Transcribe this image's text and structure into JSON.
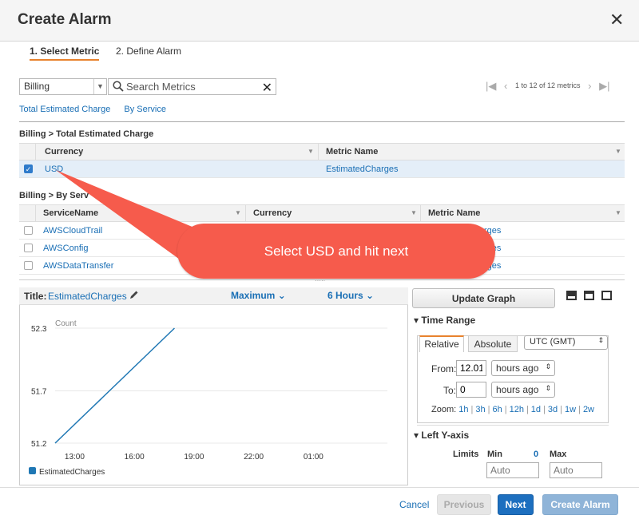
{
  "dialog": {
    "title": "Create Alarm"
  },
  "wizard": {
    "step1": "1. Select Metric",
    "step2": "2. Define Alarm"
  },
  "filter": {
    "namespace": "Billing",
    "search_placeholder": "Search Metrics",
    "pager_text": "1 to 12 of 12 metrics"
  },
  "subtabs": [
    "Total Estimated Charge",
    "By Service"
  ],
  "group1": {
    "title": "Billing > Total Estimated Charge",
    "headers": [
      "Currency",
      "Metric Name"
    ],
    "rows": [
      {
        "currency": "USD",
        "metric": "EstimatedCharges",
        "checked": true
      }
    ]
  },
  "group2": {
    "title": "Billing > By Service",
    "title_visible": "Billing > By Serv",
    "headers": [
      "ServiceName",
      "Currency",
      "Metric Name"
    ],
    "rows": [
      {
        "service": "AWSCloudTrail",
        "metric_tail": "rges"
      },
      {
        "service": "AWSConfig",
        "metric_tail": "rges"
      },
      {
        "service": "AWSDataTransfer",
        "metric_tail": "rges"
      }
    ]
  },
  "callout": {
    "text": "Select USD and hit next"
  },
  "graph": {
    "title_label": "Title:",
    "title_value": "EstimatedCharges",
    "statistic": "Maximum",
    "period": "6 Hours",
    "legend": "EstimatedCharges"
  },
  "chart_data": {
    "type": "line",
    "ylabel": "Count",
    "y_ticks": [
      "52.3",
      "51.7",
      "51.2"
    ],
    "x_ticks": [
      "13:00",
      "16:00",
      "19:00",
      "22:00",
      "01:00"
    ],
    "ylim": [
      51.2,
      52.3
    ],
    "series": [
      {
        "name": "EstimatedCharges",
        "x": [
          "12:00",
          "18:00"
        ],
        "values": [
          51.2,
          52.3
        ]
      }
    ],
    "grid": true
  },
  "right": {
    "update_button": "Update Graph",
    "time_range_title": "Time Range",
    "tab_relative": "Relative",
    "tab_absolute": "Absolute",
    "timezone": "UTC (GMT)",
    "from_label": "From:",
    "from_value": "12.01",
    "from_unit": "hours ago",
    "to_label": "To:",
    "to_value": "0",
    "to_unit": "hours ago",
    "zoom_label": "Zoom:",
    "zoom_options": [
      "1h",
      "3h",
      "6h",
      "12h",
      "1d",
      "3d",
      "1w",
      "2w"
    ],
    "yaxis_title": "Left Y-axis",
    "limits_label": "Limits",
    "min_label": "Min",
    "min_count": "0",
    "max_label": "Max",
    "min_placeholder": "Auto",
    "max_placeholder": "Auto"
  },
  "footer": {
    "cancel": "Cancel",
    "previous": "Previous",
    "next": "Next",
    "create": "Create Alarm"
  },
  "colors": {
    "accent": "#1d6fbf",
    "callout": "#f65b4c",
    "tab_underline": "#e8822d"
  }
}
